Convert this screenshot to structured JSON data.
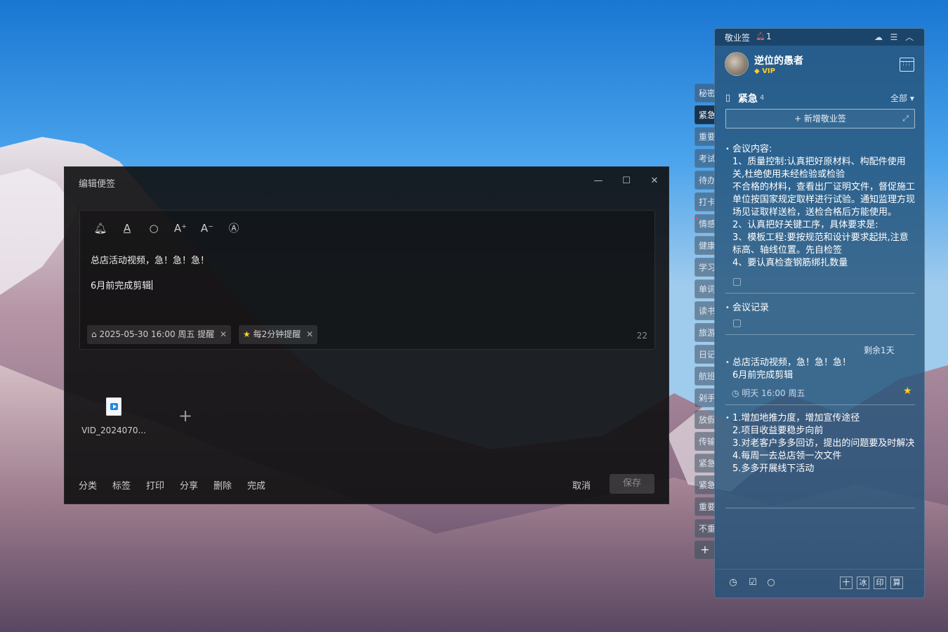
{
  "colors": {
    "accent": "#2a5a86",
    "star": "#ffd21f",
    "alert": "#ff4a3d"
  },
  "editor": {
    "title": "编辑便签",
    "window_controls": {
      "minimize": "—",
      "maximize": "☐",
      "close": "✕"
    },
    "toolbar": [
      "bell-icon",
      "font-color-icon",
      "search-icon",
      "font-increase-icon",
      "font-decrease-icon",
      "format-icon"
    ],
    "toolbar_glyphs": {
      "bell": "🔔︎",
      "font_color": "A",
      "search": "○",
      "font_up": "A⁺",
      "font_down": "A⁻",
      "format": "Ⓐ"
    },
    "content_line1": "总店活动视频，急！急！急！",
    "content_line2": "6月前完成剪辑",
    "reminder_chip": "2025-05-30 16:00 周五 提醒",
    "repeat_chip": "每2分钟提醒",
    "char_count": "22",
    "attachment_name": "VID_2024070...",
    "footer_actions": {
      "category": "分类",
      "tag": "标签",
      "print": "打印",
      "share": "分享",
      "delete": "删除",
      "complete": "完成"
    },
    "cancel_label": "取消",
    "save_label": "保存"
  },
  "tabs": [
    "秘密",
    "紧急",
    "重要",
    "考试",
    "待办",
    "打卡",
    "情感",
    "健康",
    "学习",
    "单词",
    "读书",
    "旅游",
    "日记",
    "航班",
    "剁手",
    "放假",
    "传输",
    "紧急",
    "紧急",
    "重要",
    "不重"
  ],
  "tabs_add": "+",
  "panel": {
    "app_name": "敬业签",
    "notification_count": "1",
    "user_name": "逆位的愚者",
    "vip": "VIP",
    "category": "紧急",
    "category_count": "4",
    "filter": "全部 ▾",
    "new_note": "+ 新增敬业签",
    "notes": [
      {
        "text": "会议内容:\n1、质量控制:认真把好原材料、构配件使用关,杜绝使用未经检验或检验\n不合格的材料，查看出厂证明文件，督促施工单位按国家规定取样进行试验。通知监理方现场见证取样送检，送检合格后方能使用。\n2、认真把好关键工序，具体要求是:\n3、模板工程:要按规范和设计要求起拱,注意标高、轴线位置。先自检签\n4、要认真检查钢筋绑扎数量"
      },
      {
        "text": "会议记录"
      },
      {
        "remaining": "剩余1天",
        "text": "总店活动视频，急！急！急！\n6月前完成剪辑",
        "meta": "◷ 明天 16:00 周五"
      },
      {
        "text": "1.增加地推力度，增加宣传途径\n2.项目收益要稳步向前\n3.对老客户多多回访，提出的问题要及时解决\n4.每周一去总店领一次文件\n5.多多开展线下活动"
      }
    ],
    "footer_boxes": [
      "十",
      "冰",
      "印",
      "算"
    ]
  }
}
